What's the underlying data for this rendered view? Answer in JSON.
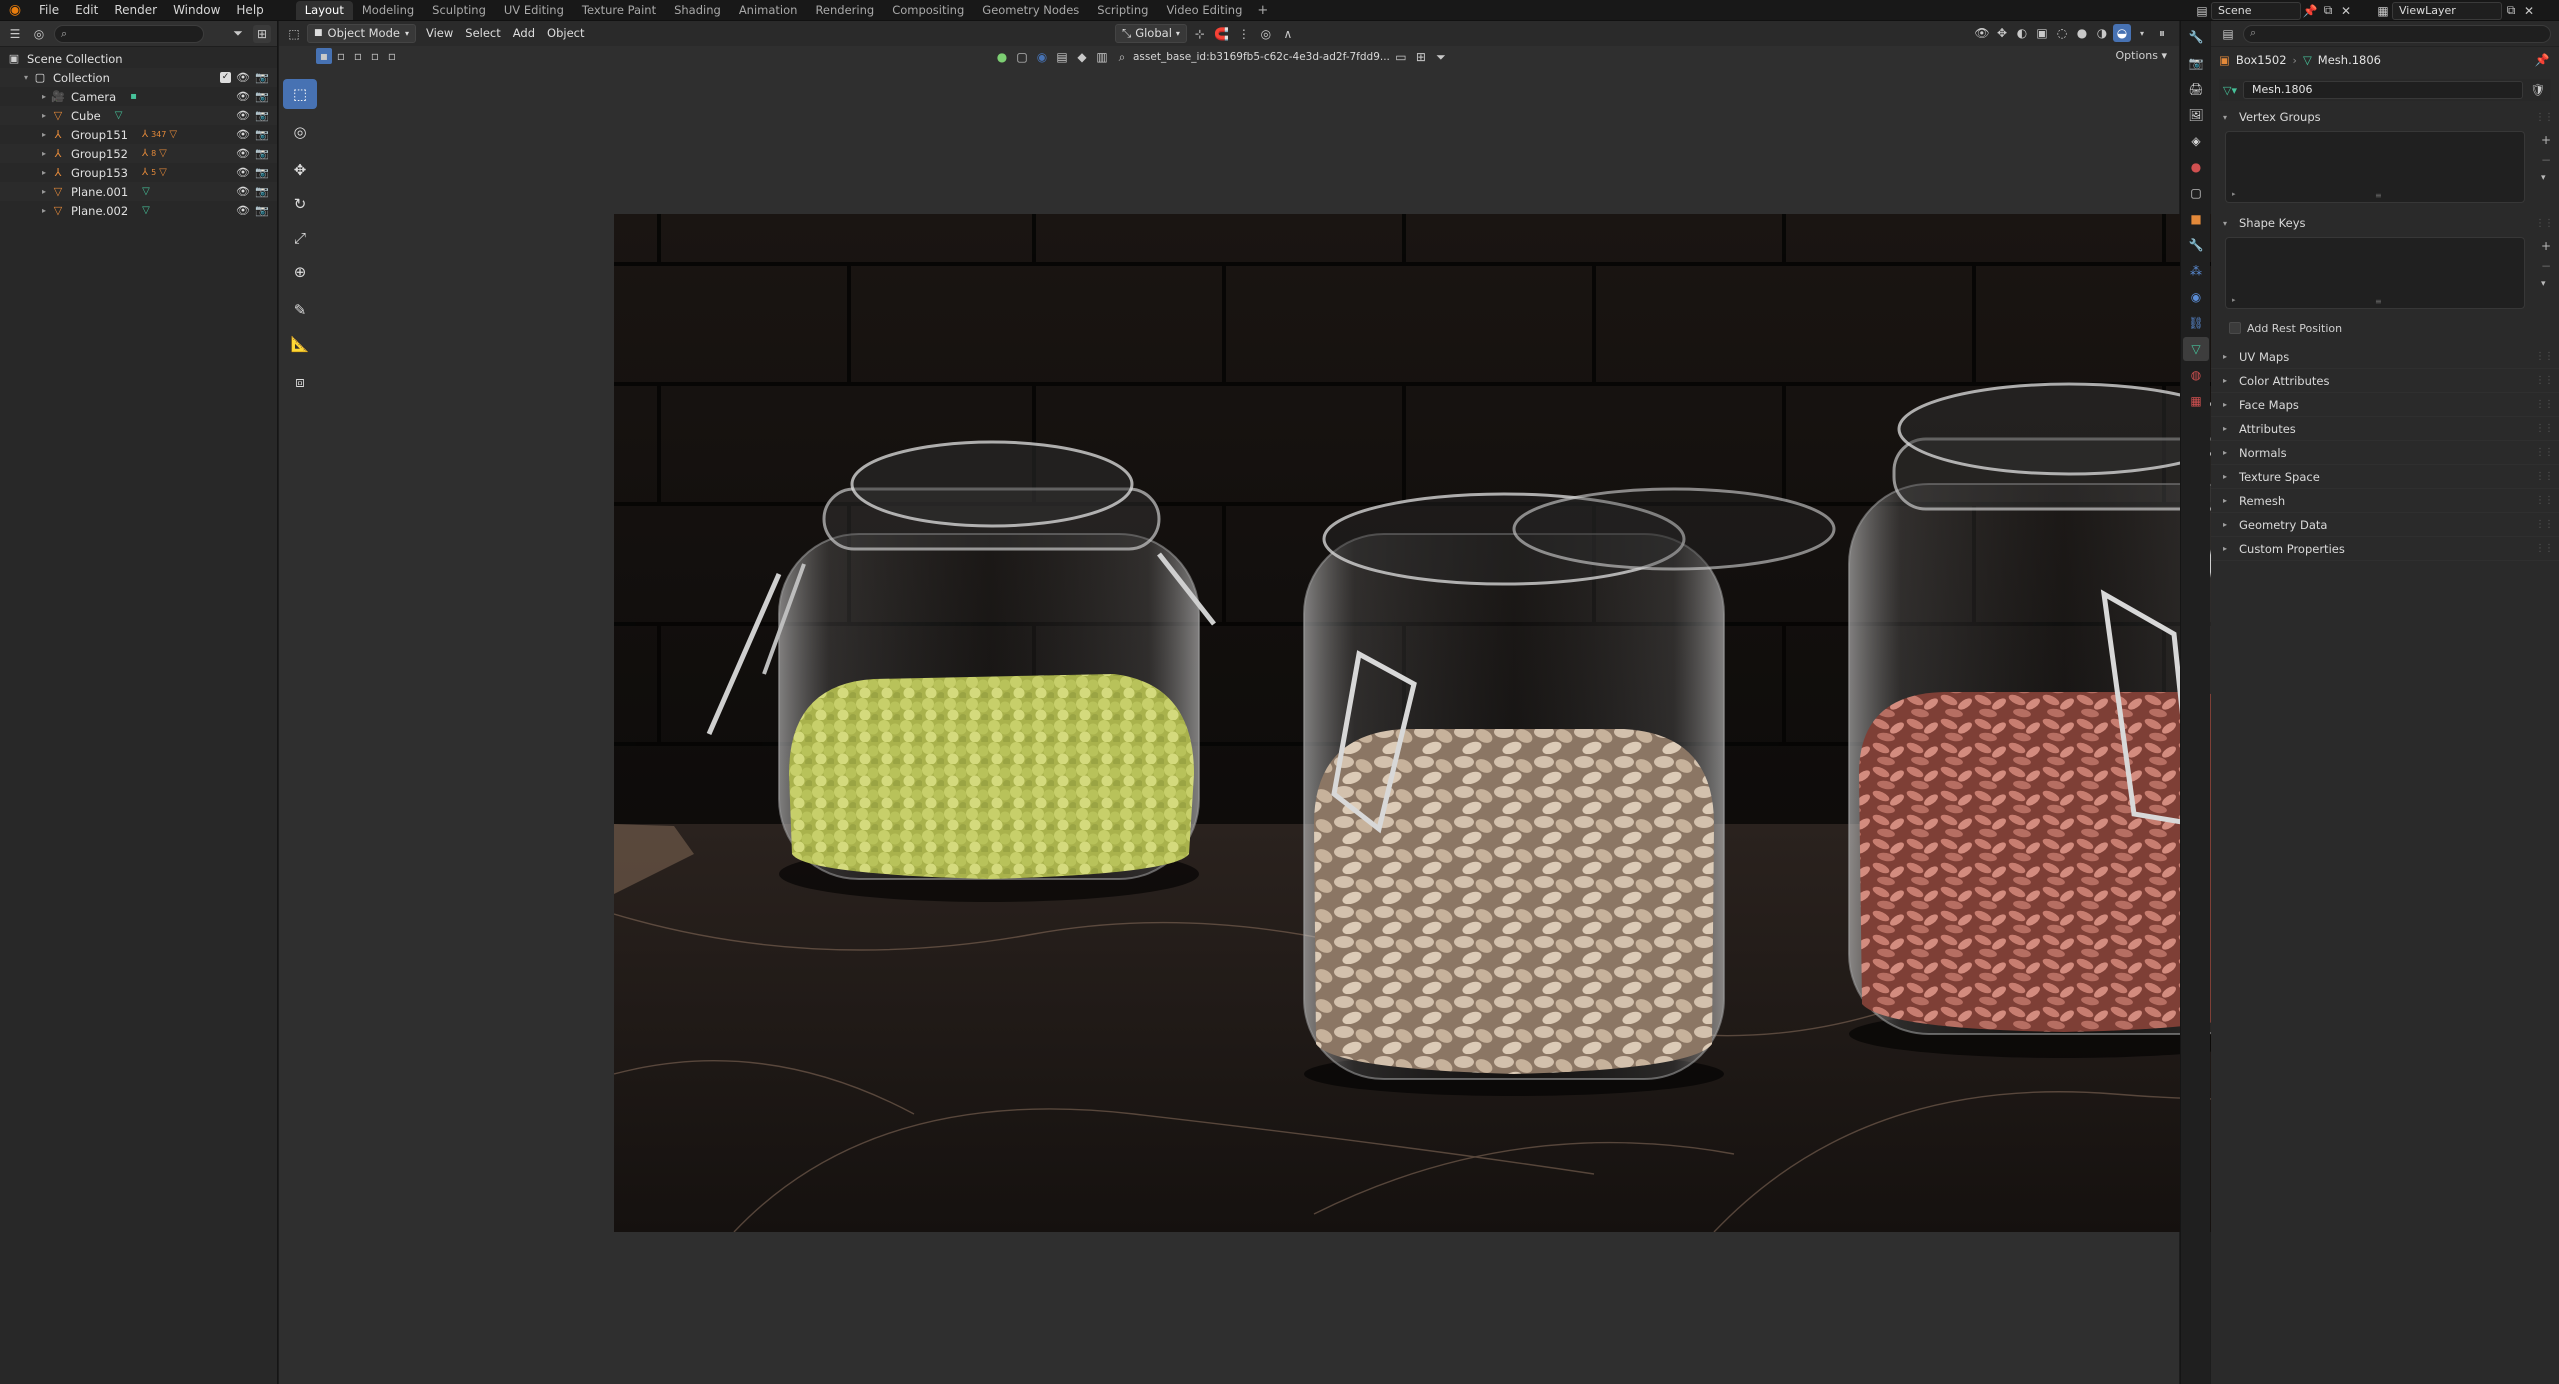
{
  "menu": [
    "File",
    "Edit",
    "Render",
    "Window",
    "Help"
  ],
  "workspaces": [
    {
      "label": "Layout",
      "active": true
    },
    {
      "label": "Modeling"
    },
    {
      "label": "Sculpting"
    },
    {
      "label": "UV Editing"
    },
    {
      "label": "Texture Paint"
    },
    {
      "label": "Shading"
    },
    {
      "label": "Animation"
    },
    {
      "label": "Rendering"
    },
    {
      "label": "Compositing"
    },
    {
      "label": "Geometry Nodes"
    },
    {
      "label": "Scripting"
    },
    {
      "label": "Video Editing"
    }
  ],
  "scene": {
    "name": "Scene",
    "view_layer": "ViewLayer"
  },
  "outliner": {
    "rows": [
      {
        "label": "Scene Collection",
        "icon": "scene-collection-icon"
      },
      {
        "label": "Collection",
        "icon": "collection-icon"
      },
      {
        "label": "Camera",
        "icon": "camera-object-icon"
      },
      {
        "label": "Cube",
        "icon": "mesh-object-icon"
      },
      {
        "label": "Group151",
        "icon": "empty-object-icon",
        "badge": "347"
      },
      {
        "label": "Group152",
        "icon": "empty-object-icon",
        "badge": "8"
      },
      {
        "label": "Group153",
        "icon": "empty-object-icon",
        "badge": "5"
      },
      {
        "label": "Plane.001",
        "icon": "mesh-object-icon"
      },
      {
        "label": "Plane.002",
        "icon": "mesh-object-icon"
      }
    ]
  },
  "viewport": {
    "editor_icon": "3d-viewport-icon",
    "mode": "Object Mode",
    "menus": [
      "View",
      "Select",
      "Add",
      "Object"
    ],
    "orientation": "Global",
    "asset_id": "asset_base_id:b3169fb5-c62c-4e3d-ad2f-7fdd9...",
    "options_label": "Options",
    "tools": [
      "select-box-icon",
      "cursor-icon",
      "move-icon",
      "rotate-icon",
      "scale-icon",
      "transform-icon",
      "annotate-icon",
      "measure-icon",
      "add-cube-icon"
    ],
    "render_image": "Three glass jars with clamp lids on a dark marble counter against black subway tiles: green peas, almonds, pink beans"
  },
  "properties": {
    "object_name": "Box1502",
    "mesh_name": "Mesh.1806",
    "mesh_field_value": "Mesh.1806",
    "open_panels": [
      "Vertex Groups",
      "Shape Keys"
    ],
    "add_rest_position": "Add Rest Position",
    "closed_panels": [
      "UV Maps",
      "Color Attributes",
      "Face Maps",
      "Attributes",
      "Normals",
      "Texture Space",
      "Remesh",
      "Geometry Data",
      "Custom Properties"
    ]
  },
  "colors": {
    "accent": "#4772b3",
    "orange_object": "#e3893a",
    "mesh_green": "#46c29a",
    "background": "#1d1d1d"
  }
}
